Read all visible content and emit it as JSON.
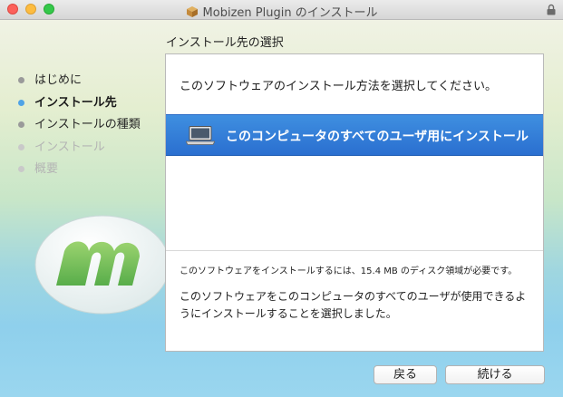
{
  "window": {
    "title": "Mobizen Plugin のインストール",
    "icons": {
      "title": "package-icon",
      "lock": "lock-icon"
    }
  },
  "section_heading": "インストール先の選択",
  "steps": [
    {
      "label": "はじめに",
      "state": "done"
    },
    {
      "label": "インストール先",
      "state": "current"
    },
    {
      "label": "インストールの種類",
      "state": "done"
    },
    {
      "label": "インストール",
      "state": "todo"
    },
    {
      "label": "概要",
      "state": "todo"
    }
  ],
  "panel": {
    "prompt": "このソフトウェアのインストール方法を選択してください。",
    "option": {
      "label": "このコンピュータのすべてのユーザ用にインストール",
      "icon": "laptop-icon"
    },
    "space_note": "このソフトウェアをインストールするには、15.4 MB のディスク領域が必要です。",
    "selected_description": "このソフトウェアをこのコンピュータのすべてのユーザが使用できるようにインストールすることを選択しました。"
  },
  "buttons": {
    "back": "戻る",
    "continue": "続ける"
  },
  "colors": {
    "selection": "#2f7bd8",
    "current_step_dot": "#4fa3e6",
    "logo_green": "#7ec460"
  }
}
